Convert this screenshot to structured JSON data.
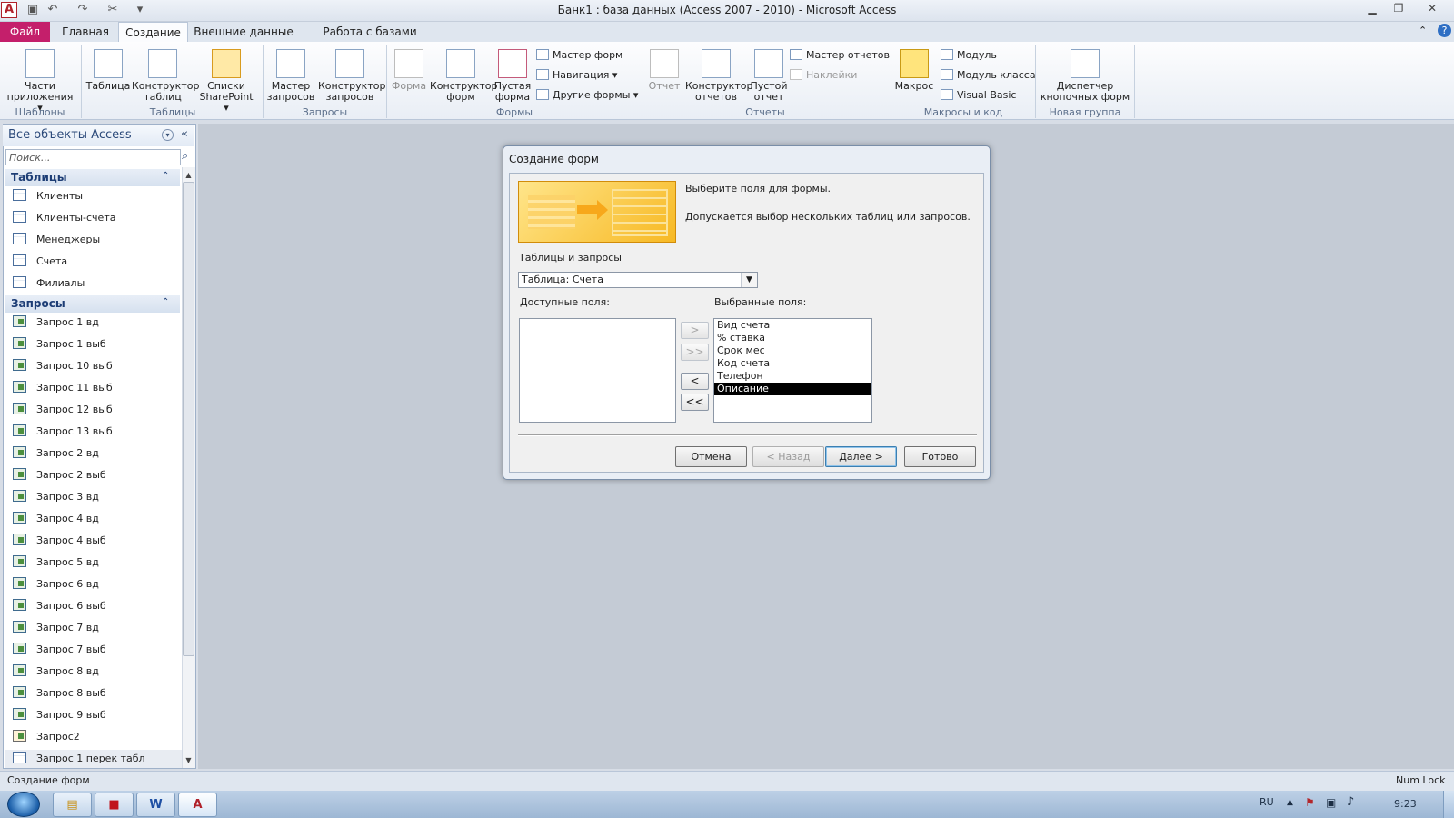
{
  "window": {
    "title": "Банк1 : база данных (Access 2007 - 2010)  -  Microsoft Access"
  },
  "ribbon": {
    "tabs": [
      "Файл",
      "Главная",
      "Создание",
      "Внешние данные",
      "Работа с базами данных"
    ],
    "groups": {
      "templates": {
        "label": "Шаблоны",
        "app_parts_line1": "Части",
        "app_parts_line2": "приложения ▾"
      },
      "tables": {
        "label": "Таблицы",
        "table": "Таблица",
        "designer_line1": "Конструктор",
        "designer_line2": "таблиц",
        "sharepoint_line1": "Списки",
        "sharepoint_line2": "SharePoint ▾"
      },
      "queries": {
        "label": "Запросы",
        "wizard_line1": "Мастер",
        "wizard_line2": "запросов",
        "designer_line1": "Конструктор",
        "designer_line2": "запросов"
      },
      "forms": {
        "label": "Формы",
        "form": "Форма",
        "designer_line1": "Конструктор",
        "designer_line2": "форм",
        "blank_line1": "Пустая",
        "blank_line2": "форма",
        "form_wizard": "Мастер форм",
        "navigation": "Навигация ▾",
        "other_forms": "Другие формы ▾"
      },
      "reports": {
        "label": "Отчеты",
        "report": "Отчет",
        "designer_line1": "Конструктор",
        "designer_line2": "отчетов",
        "blank_line1": "Пустой",
        "blank_line2": "отчет",
        "report_wizard": "Мастер отчетов",
        "labels": "Наклейки"
      },
      "macros": {
        "label": "Макросы и код",
        "macro": "Макрос",
        "module": "Модуль",
        "class_module": "Модуль класса",
        "vba": "Visual Basic"
      },
      "newgroup": {
        "label": "Новая группа",
        "switchboard_line1": "Диспетчер",
        "switchboard_line2": "кнопочных форм"
      }
    }
  },
  "nav": {
    "title": "Все объекты Access",
    "search_placeholder": "Поиск...",
    "tables_header": "Таблицы",
    "tables": [
      "Клиенты",
      "Клиенты-счета",
      "Менеджеры",
      "Счета",
      "Филиалы"
    ],
    "queries_header": "Запросы",
    "queries": [
      "Запрос 1 вд",
      "Запрос 1 выб",
      "Запрос 10 выб",
      "Запрос 11 выб",
      "Запрос 12 выб",
      "Запрос 13 выб",
      "Запрос 2 вд",
      "Запрос 2 выб",
      "Запрос 3 вд",
      "Запрос 4 вд",
      "Запрос 4 выб",
      "Запрос 5 вд",
      "Запрос 6 вд",
      "Запрос 6 выб",
      "Запрос 7 вд",
      "Запрос 7 выб",
      "Запрос 8 вд",
      "Запрос 8 выб",
      "Запрос 9 выб",
      "Запрос2",
      "Запрос 1 перек табл"
    ]
  },
  "dialog": {
    "title": "Создание форм",
    "instruction1": "Выберите поля для формы.",
    "instruction2": "Допускается выбор нескольких таблиц или запросов.",
    "tables_label": "Таблицы и запросы",
    "combo_value": "Таблица: Счета",
    "available_label": "Доступные поля:",
    "selected_label": "Выбранные поля:",
    "selected_fields": [
      "Вид счета",
      "% ставка",
      "Срок мес",
      "Код счета",
      "Телефон",
      "Описание"
    ],
    "move_buttons": [
      ">",
      ">>",
      "<",
      "<<"
    ],
    "cancel": "Отмена",
    "back": "< Назад",
    "next": "Далее >",
    "finish": "Готово"
  },
  "status": {
    "left": "Создание форм",
    "right": "Num Lock"
  },
  "taskbar": {
    "lang": "RU",
    "time": "9:23"
  },
  "colors": {
    "file_tab": "#c41f6b",
    "selection": "#000000",
    "accent": "#2c4a7a"
  }
}
